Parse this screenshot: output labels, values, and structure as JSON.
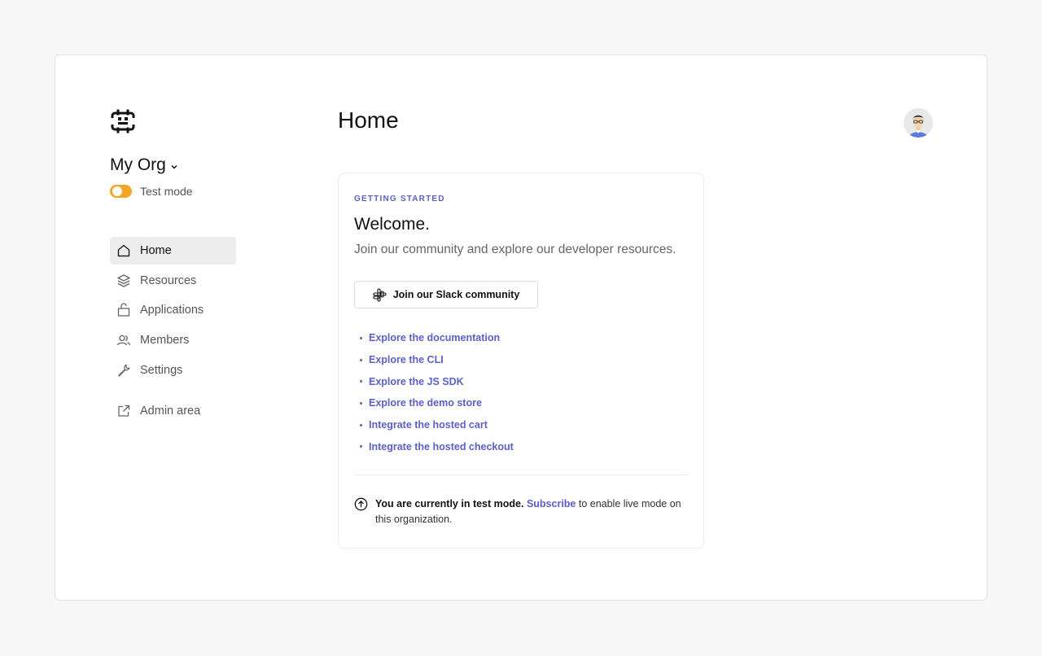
{
  "org": {
    "name": "My Org"
  },
  "test_mode": {
    "label": "Test mode",
    "enabled": true,
    "toggle_color": "#f5a524"
  },
  "sidebar": {
    "items": [
      {
        "label": "Home",
        "icon": "home-icon",
        "active": true
      },
      {
        "label": "Resources",
        "icon": "layers-icon"
      },
      {
        "label": "Applications",
        "icon": "package-icon"
      },
      {
        "label": "Members",
        "icon": "users-icon"
      },
      {
        "label": "Settings",
        "icon": "wrench-icon"
      }
    ],
    "admin": {
      "label": "Admin area",
      "icon": "external-link-icon"
    }
  },
  "header": {
    "title": "Home"
  },
  "card": {
    "eyebrow": "GETTING STARTED",
    "title": "Welcome.",
    "subtitle": "Join our community and explore our developer resources.",
    "slack_button": "Join our Slack community",
    "links": [
      "Explore the documentation",
      "Explore the CLI",
      "Explore the JS SDK",
      "Explore the demo store",
      "Integrate the hosted cart",
      "Integrate the hosted checkout"
    ],
    "notice": {
      "bold": "You are currently in test mode.",
      "link": "Subscribe",
      "rest": " to enable live mode on this organization."
    }
  },
  "colors": {
    "accent": "#5b5fc7",
    "active_nav_bg": "#ececec"
  }
}
